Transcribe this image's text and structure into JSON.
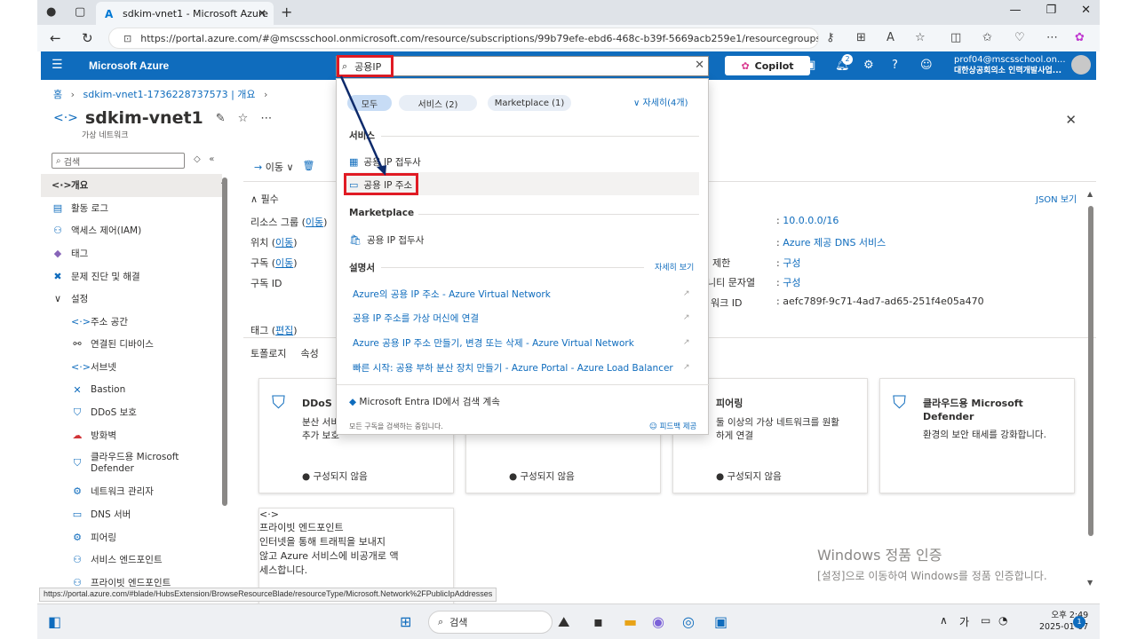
{
  "browser": {
    "tab_title": "sdkim-vnet1 - Microsoft Azure",
    "url": "https://portal.azure.com/#@mscsschool.onmicrosoft.com/resource/subscriptions/99b79efe-ebd6-468c-b39f-5669acb259e1/resourcegroups/sdkim-r...",
    "status_url": "https://portal.azure.com/#blade/HubsExtension/BrowseResourceBlade/resourceType/Microsoft.Network%2FPublicIpAddresses"
  },
  "header": {
    "brand": "Microsoft Azure",
    "search_value": "공용IP",
    "copilot": "Copilot",
    "notification_count": "2",
    "account_email": "prof04@mscsschool.on...",
    "account_org": "대한상공회의소 인력개발사업..."
  },
  "breadcrumb": {
    "home": "홈",
    "item": "sdkim-vnet1-1736228737573 | 개요"
  },
  "resource": {
    "name": "sdkim-vnet1",
    "type": "가상 네트워크"
  },
  "sidebar": {
    "search_placeholder": "검색",
    "items": [
      {
        "label": "개요",
        "icon": "<·>"
      },
      {
        "label": "활동 로그",
        "icon": "▤"
      },
      {
        "label": "액세스 제어(IAM)",
        "icon": "⚇"
      },
      {
        "label": "태그",
        "icon": "◆"
      },
      {
        "label": "문제 진단 및 해결",
        "icon": "✖"
      },
      {
        "label": "설정",
        "icon": "∨"
      },
      {
        "label": "주소 공간",
        "icon": "<·>"
      },
      {
        "label": "연결된 디바이스",
        "icon": "⚯"
      },
      {
        "label": "서브넷",
        "icon": "<·>"
      },
      {
        "label": "Bastion",
        "icon": "✕"
      },
      {
        "label": "DDoS 보호",
        "icon": "⛉"
      },
      {
        "label": "방화벽",
        "icon": "☁"
      },
      {
        "label": "클라우드용 Microsoft Defender",
        "icon": "⛉"
      },
      {
        "label": "네트워크 관리자",
        "icon": "⚙"
      },
      {
        "label": "DNS 서버",
        "icon": "▭"
      },
      {
        "label": "피어링",
        "icon": "⚙"
      },
      {
        "label": "서비스 엔드포인트",
        "icon": "⚇"
      },
      {
        "label": "프라이빗 엔드포인트",
        "icon": "⚇"
      }
    ]
  },
  "toolbar": {
    "move": "이동",
    "delete_icon": "trash-icon"
  },
  "essentials": {
    "title": "필수",
    "json_view": "JSON 보기",
    "resource_group_label": "리소스 그룹",
    "move": "이동",
    "location_label": "위치",
    "subscription_label": "구독",
    "subscription_id_label": "구독 ID",
    "tags_label": "태그",
    "edit": "편집",
    "address_space_value": "10.0.0.0/16",
    "dns_value": "Azure 제공 DNS 서비스",
    "limit_label": "제한",
    "limit_value": "구성",
    "community_label": "니티 문자열",
    "community_value": "구성",
    "network_id_label": "워크 ID",
    "network_id_value": "aefc789f-9c71-4ad7-ad65-251f4e05a470"
  },
  "tabs": [
    "토폴로지",
    "속성"
  ],
  "cards": [
    {
      "title": "DDoS 5",
      "desc": "분산 서비\n추가 보호",
      "status": "구성되지 않음"
    },
    {
      "title": "",
      "desc": "",
      "status": "구성되지 않음"
    },
    {
      "title": "피어링",
      "desc": "둘 이상의 가상 네트워크를 원활\n하게 연결",
      "status": "구성되지 않음"
    },
    {
      "title": "클라우드용 Microsoft\nDefender",
      "desc": "환경의 보안 태세를 강화합니다.",
      "status": ""
    },
    {
      "title": "프라이빗 엔드포인트",
      "desc": "인터넷을 통해 트래픽을 보내지\n않고 Azure 서비스에 비공개로 액\n세스합니다.",
      "status": ""
    }
  ],
  "dropdown": {
    "filters": [
      "모두",
      "서비스  (2)",
      "Marketplace  (1)"
    ],
    "more": "자세히(4개)",
    "services_title": "서비스",
    "services": [
      "공용 IP 접두사",
      "공용 IP 주소"
    ],
    "marketplace_title": "Marketplace",
    "marketplace": [
      "공용 IP 접두사"
    ],
    "docs_title": "설명서",
    "docs_more": "자세히 보기",
    "docs": [
      "Azure의 공용 IP 주소 - Azure Virtual Network",
      "공용 IP 주소를 가상 머신에 연결",
      "Azure 공용 IP 주소 만들기, 변경 또는 삭제 - Azure Virtual Network",
      "빠른 시작: 공용 부하 분산 장치 만들기 - Azure Portal - Azure Load Balancer"
    ],
    "entra": "Microsoft Entra ID에서 검색 계속",
    "footer_note": "모든 구독을 검색하는 중입니다.",
    "feedback": "피드백 제공"
  },
  "watermark": {
    "line1": "Windows 정품 인증",
    "line2": "[설정]으로 이동하여 Windows를 정품 인증합니다."
  },
  "taskbar": {
    "search": "검색",
    "ime": "가",
    "time": "오후 2:49",
    "date": "2025-01-07",
    "notif": "1"
  },
  "colors": {
    "azure_blue": "#0f6cbd",
    "highlight_red": "#e01b24"
  }
}
